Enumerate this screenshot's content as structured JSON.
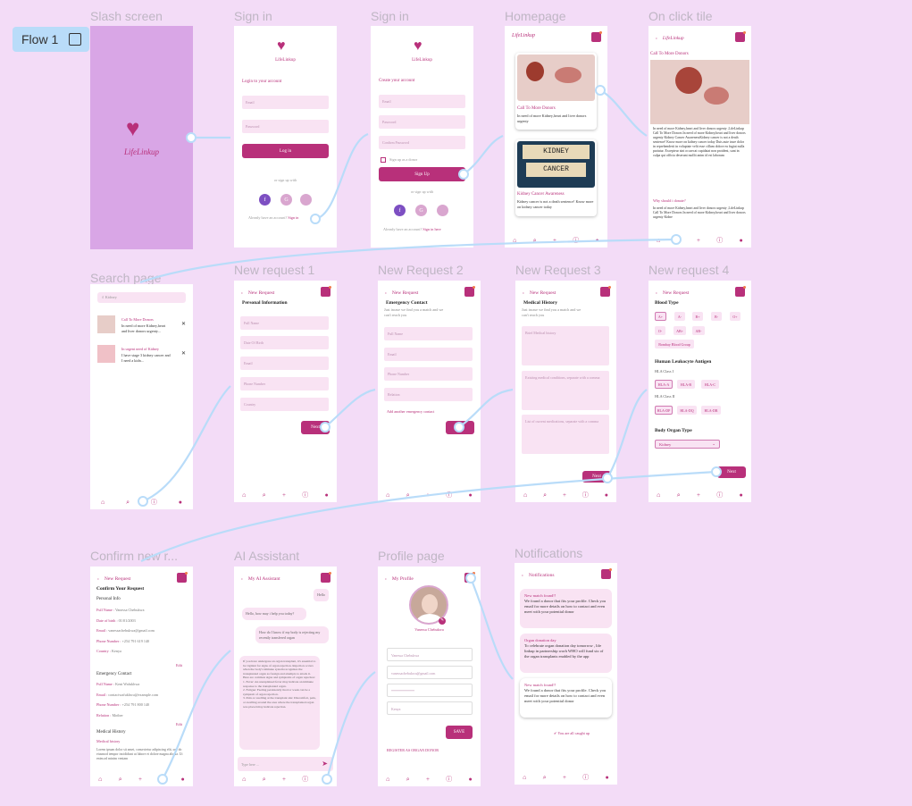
{
  "flow": {
    "label": "Flow 1"
  },
  "labels": [
    "Slash screen",
    "Sign in",
    "Sign in",
    "Homepage",
    "On click tile",
    "Search page",
    "New request 1",
    "New Request 2",
    "New Request 3",
    "New request 4",
    "Confirm new r...",
    "AI Assistant",
    "Profile page",
    "Notifications"
  ],
  "brand": "LifeLinkup",
  "signin": {
    "heading": "Login to your account",
    "email": "Email",
    "password": "Password",
    "button": "Log in",
    "or": "or sign up with",
    "footer": "Already have an account?",
    "footer_link": "Sign in"
  },
  "signup": {
    "heading": "Create your account",
    "email": "Email",
    "password": "Password",
    "confirm": "Confirm Password",
    "check": "Sign up as a donor",
    "button": "Sign Up",
    "or": "or sign up with",
    "footer": "Already have an account?",
    "footer_link": "Sign in here"
  },
  "home": {
    "card1_title": "Call To More Donors",
    "card1_text": "In need of more Kidney,heart and liver donors urgenty",
    "card2_title": "Kidney Cancer Awareness",
    "card2_text": "Kidney cancer is not a death sentence! Know more on kidney cancer today",
    "kidney_word": "KIDNEY",
    "cancer_word": "CANCER"
  },
  "tile": {
    "title": "Call To More Donors",
    "body1": "In need of more Kidney,heart and liver donors urgenty ,LifeLinkup Call To More Donors In need of more Kidney,heart and liver donors urgenty Kidney Cancer AwarenessKidney cancer is not a death sentence! Know more on kidney cancer today Duis aute irure dolor in reprehenderit in voluptate velit esse cillum dolore eu fugiat nulla pariatur. Excepteur sint occaecat cupidatat non proident, sunt in culpa qui officia deserunt mollit anim id est laborum",
    "why": "Why should i donate?",
    "body2": "In need of more Kidney,heart and liver donors urgenty ,LifeLinkup Call To More Donors In need of more Kidney,heart and liver donors urgenty Kidne"
  },
  "search": {
    "placeholder": "Kidney",
    "r1_title": "Call To More Donors",
    "r1_text": "In need of more Kidney,heart and liver donors urgenty...",
    "r2_title": "In urgent need of Kidney",
    "r2_text": "I have stage 3 kidney cancer and I need a kidn..."
  },
  "req": {
    "title": "New Request",
    "next": "Next"
  },
  "req1": {
    "heading": "Personal Information",
    "fields": [
      "Full Name",
      "Date Of Birth",
      "Email",
      "Phone Number",
      "Country"
    ]
  },
  "req2": {
    "heading": "Emergency Contact",
    "sub": "Just incase we find you a match and we can't reach you",
    "fields": [
      "Full Name",
      "Email",
      "Phone Number",
      "Relation"
    ],
    "add": "Add another emergency contact"
  },
  "req3": {
    "heading": "Medical History",
    "sub": "Just incase we find you a match and we can't reach you",
    "fields": [
      "Brief Medical history",
      "Existing medical conditions, separate with a comma",
      "List of current medications, separate with a comma"
    ]
  },
  "req4": {
    "blood": "Blood Type",
    "types": [
      "A+",
      "A-",
      "B+",
      "B-",
      "O+",
      "O-",
      "AB+",
      "AB-"
    ],
    "bombay": "Bombay Blood Group",
    "hla": "Human Leukocyte Antigen",
    "c1": "HLA Class I",
    "c1_opts": [
      "HLA-A",
      "HLA-B",
      "HLA-C"
    ],
    "c2": "HLA Class II",
    "c2_opts": [
      "HLA-DP",
      "HLA-DQ",
      "HLA-DR"
    ],
    "organ": "Body Organ Type",
    "organ_val": "Kidney"
  },
  "confirm": {
    "heading": "Confirm Your Request",
    "personal": "Personal Info",
    "rows": [
      [
        "Full Name :",
        "Vanessa Chebukwa"
      ],
      [
        "Date of birth :",
        "01/01/2003"
      ],
      [
        "Email :",
        "vanessachebukwa@gmail.com"
      ],
      [
        "Phone Number :",
        "+254 791 619 140"
      ],
      [
        "Country :",
        "Kenya"
      ]
    ],
    "edit": "Edit",
    "emergency": "Emergency Contact",
    "erows": [
      [
        "Full Name :",
        "Kent Wafukhwa"
      ],
      [
        "Email :",
        "contactwafukhwa@example.com"
      ],
      [
        "Phone Number :",
        "+254 791 800 140"
      ],
      [
        "Relation :",
        "Mother"
      ]
    ],
    "medical": "Medical History",
    "medsub": "Medical history",
    "medtext": "Lorem ipsum dolor sit amet, consectetur adipiscing elit, sed do eiusmod tempor incididunt ut labore et dolore magna aliqua. Ut enim ad minim veniam"
  },
  "ai": {
    "title": "My AI Assistant",
    "m1": "Hello",
    "m2": "Hello, how may i help you today?",
    "m3": "How do I know if my body is rejecting my recently transfered organ",
    "m4": "If you have undergone an organ transplant, it's essential to be vigilant for signs of organ rejection. Rejection occurs when the body's immune system recognizes the transplanted organ as foreign and attempts to attack it. Here are common signs and symptoms of organ rejection:\n1. Fever: An unexplained fever may indicate an immune response to the transplanted organ.\n2. Fatigue: Feeling persistently tired or weak can be a symptom of organ rejection.\n3. Pain or swelling at the transplant site: Discomfort, pain, or swelling around the area where the transplanted organ was placed may indicate rejection.",
    "input": "Type here ..."
  },
  "profile": {
    "title": "My Profile",
    "name": "Vanessa Chebukwa",
    "f1": "Vanessa Chebukwa",
    "f2": "vanessachebukwa@gmail.com",
    "f3": "*************",
    "f4": "Kenya",
    "save": "SAVE",
    "register": "REGISTER AS ORGAN DONOR"
  },
  "notif": {
    "title": "Notifications",
    "n1_t": "New match found!!",
    "n1_b": "We found a donor that fits your profile. Check you email for more details on how to contact and even meet with your potential donor",
    "n2_t": "Organ donation day",
    "n2_b": "To celebrate organ donation day tomorrow , life linkup in partnership worh WHO will fund six of the organ transplants enabled by the app",
    "n3_t": "New match found!!",
    "n3_b": "We found a donor that fits your profile. Check you email for more details on how to contact and even meet with your potential donor",
    "caught": "You are all caught up"
  },
  "colors": {
    "brand": "#b8307a",
    "canvas": "#f3dcf7",
    "field": "#f9e3f3",
    "splash": "#d9a6e6",
    "line": "#b9dcf9"
  }
}
